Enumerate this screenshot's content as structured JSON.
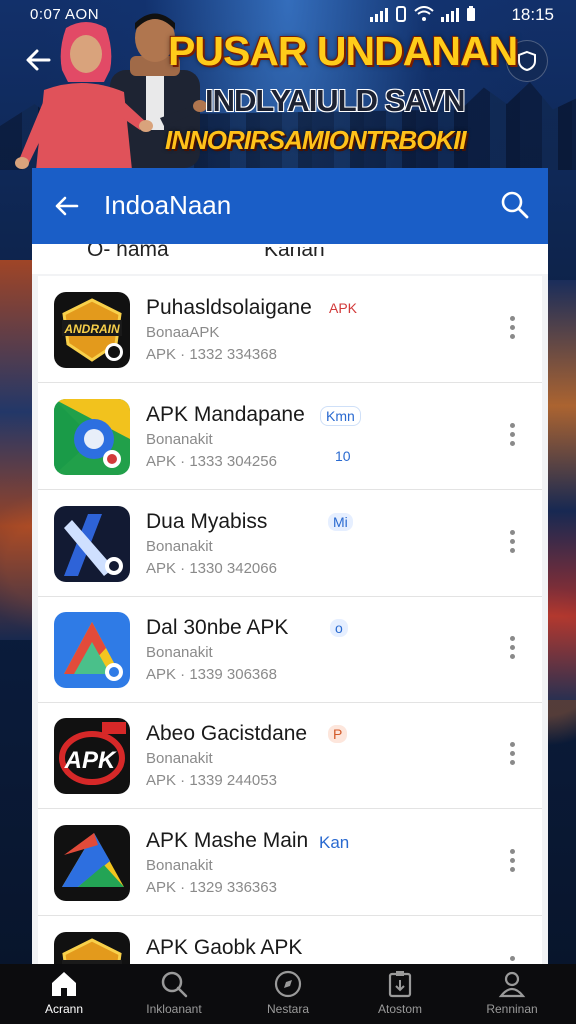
{
  "status_bar": {
    "time_left": "0:07 AON",
    "time_right": "18:15"
  },
  "banner": {
    "title": "PUSAR UNDANAN",
    "subtitle": "INDLYAIULD SAVN",
    "tagline": "INNORIRSAMIONTRBOKII"
  },
  "appbar": {
    "title": "IndoaNaan"
  },
  "tabs": [
    {
      "label": "O- hama"
    },
    {
      "label": "Kanan"
    }
  ],
  "apps": [
    {
      "name": "Puhasldsolaigane",
      "tag": "APK",
      "tag_color": "#d23a3a",
      "developer": "BonaaAPK",
      "meta": "APK · 1332 334368",
      "icon": "badge-dark-icon",
      "tag2": ""
    },
    {
      "name": "APK Mandapane",
      "tag": "Kmn",
      "tag_color": "#2a6ad0",
      "developer": "Bonanakit",
      "meta": "APK · 1333 304256",
      "icon": "google-style-icon",
      "tag2": "10"
    },
    {
      "name": "Dua Myabiss",
      "tag": "Mi",
      "tag_color": "#2a6ad0",
      "developer": "Bonanakit",
      "meta": "APK · 1330 342066",
      "icon": "blue-x-icon",
      "tag2": ""
    },
    {
      "name": "Dal 30nbe APK",
      "tag": "o",
      "tag_color": "#2a6ad0",
      "developer": "Bonanakit",
      "meta": "APK · 1339 306368",
      "icon": "triangle-play-icon",
      "tag2": ""
    },
    {
      "name": "Abeo  Gacistdane",
      "tag": "P",
      "tag_color": "#d25a2a",
      "developer": "Bonanakit",
      "meta": "APK · 1339 244053",
      "icon": "apk-red-icon",
      "tag2": ""
    },
    {
      "name": "APK Mashe Main",
      "tag": "Kan",
      "tag_color": "#2a6ad0",
      "developer": "Bonanakit",
      "meta": "APK · 1329 336363",
      "icon": "color-triangle-icon",
      "tag2": ""
    },
    {
      "name": "APK Gaobk APK",
      "tag": "",
      "tag_color": "#2a6ad0",
      "developer": "",
      "meta": "",
      "icon": "badge-dark-icon",
      "tag2": ""
    }
  ],
  "navbar": [
    {
      "label": "Acrann",
      "icon": "home-icon"
    },
    {
      "label": "Inkloanant",
      "icon": "search-icon"
    },
    {
      "label": "Nestara",
      "icon": "compass-icon"
    },
    {
      "label": "Atostom",
      "icon": "download-box-icon"
    },
    {
      "label": "Renninan",
      "icon": "profile-icon"
    }
  ]
}
